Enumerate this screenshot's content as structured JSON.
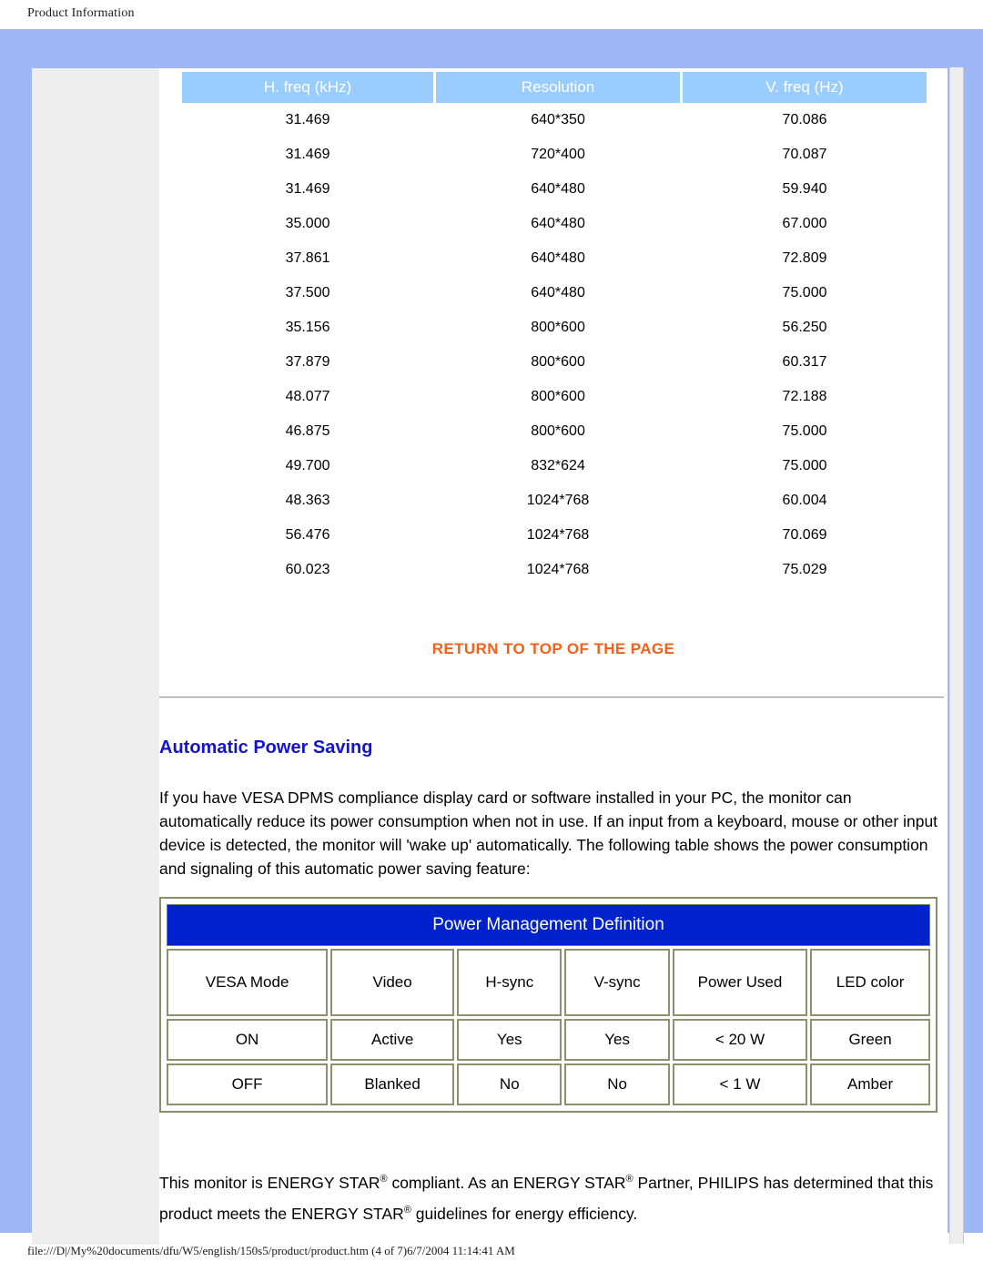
{
  "running_head": "Product Information",
  "timings_table": {
    "columns": [
      "H. freq (kHz)",
      "Resolution",
      "V. freq (Hz)"
    ],
    "rows": [
      [
        "31.469",
        "640*350",
        "70.086"
      ],
      [
        "31.469",
        "720*400",
        "70.087"
      ],
      [
        "31.469",
        "640*480",
        "59.940"
      ],
      [
        "35.000",
        "640*480",
        "67.000"
      ],
      [
        "37.861",
        "640*480",
        "72.809"
      ],
      [
        "37.500",
        "640*480",
        "75.000"
      ],
      [
        "35.156",
        "800*600",
        "56.250"
      ],
      [
        "37.879",
        "800*600",
        "60.317"
      ],
      [
        "48.077",
        "800*600",
        "72.188"
      ],
      [
        "46.875",
        "800*600",
        "75.000"
      ],
      [
        "49.700",
        "832*624",
        "75.000"
      ],
      [
        "48.363",
        "1024*768",
        "60.004"
      ],
      [
        "56.476",
        "1024*768",
        "70.069"
      ],
      [
        "60.023",
        "1024*768",
        "75.029"
      ]
    ]
  },
  "return_to_top": "RETURN TO TOP OF THE PAGE",
  "section": {
    "heading": "Automatic Power Saving",
    "paragraph": "If you have VESA DPMS compliance display card or software installed in your PC, the monitor can automatically reduce its power consumption when not in use. If an input from a keyboard, mouse or other input device is detected, the monitor will 'wake up' automatically. The following table shows the power consumption and signaling of this automatic power saving feature:"
  },
  "power_table": {
    "title": "Power Management Definition",
    "columns": [
      "VESA Mode",
      "Video",
      "H-sync",
      "V-sync",
      "Power Used",
      "LED color"
    ],
    "rows": [
      [
        "ON",
        "Active",
        "Yes",
        "Yes",
        "< 20 W",
        "Green"
      ],
      [
        "OFF",
        "Blanked",
        "No",
        "No",
        "< 1 W",
        "Amber"
      ]
    ]
  },
  "energy_star": {
    "line1_a": "This monitor is ENERGY STAR",
    "line1_reg1": "®",
    "line1_b": " compliant. As an ENERGY STAR",
    "line1_reg2": "®",
    "line1_c": " Partner, PHILIPS has determined that this product meets the ENERGY STAR",
    "line1_reg3": "®",
    "line1_d": " guidelines for energy efficiency."
  },
  "footer": "file:///D|/My%20documents/dfu/W5/english/150s5/product/product.htm (4 of 7)6/7/2004 11:14:41 AM",
  "colors": {
    "frame_blue": "#9fb8f5",
    "header_cell_blue": "#99ccff",
    "link_orange": "#f4601a",
    "heading_blue": "#1313d3",
    "pm_title_blue": "#0022cc",
    "rail_gray": "#eeeeee"
  }
}
